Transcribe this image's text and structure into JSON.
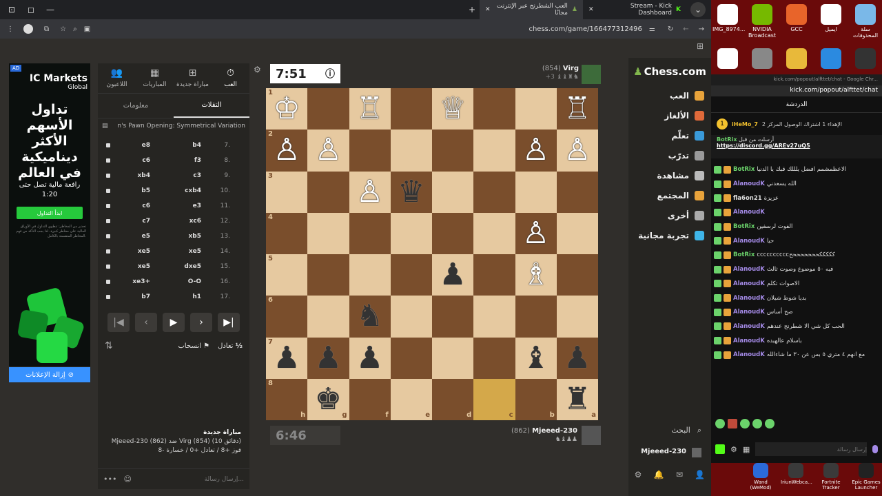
{
  "browser": {
    "tabs": [
      {
        "label": "Stream - Kick Dashboard",
        "active": false
      },
      {
        "label": "العب الشطرنج عبر الإنترنت مجانًا",
        "active": true
      }
    ],
    "address": "chess.com/game/166477312496"
  },
  "ad": {
    "brand": "IC Markets",
    "brand_sub": "Global",
    "headline": "تداول الأسهم الأكثر ديناميكية في العالم",
    "sub": "رافعة مالية تصل حتى 1:20",
    "cta": "ابدأ التداول",
    "disclaimer": "تحذير من المخاطر: تنطوي التداول في الأوراق المالية على مخاطر كبيرة، لذا يجب التأكد من فهم المخاطر المتضمنة بالكامل.",
    "remove_label": "إزالة الإعلانات"
  },
  "left_panel": {
    "tabs": [
      {
        "label": "اللاعبون",
        "icon": "players-icon"
      },
      {
        "label": "المباريات",
        "icon": "games-icon"
      },
      {
        "label": "مباراة جديدة",
        "icon": "plus-icon"
      },
      {
        "label": "العب",
        "icon": "stopwatch-icon",
        "active": true
      }
    ],
    "subtabs": {
      "info": "معلومات",
      "moves": "التقلات"
    },
    "opening": "n's Pawn Opening: Symmetrical Variation",
    "moves": [
      {
        "n": "7.",
        "w": "b4",
        "b": "e8"
      },
      {
        "n": "8.",
        "w": "f3",
        "b": "c6"
      },
      {
        "n": "9.",
        "w": "c3",
        "b": "xb4"
      },
      {
        "n": "10.",
        "w": "cxb4",
        "b": "b5"
      },
      {
        "n": "11.",
        "w": "e3",
        "b": "c6"
      },
      {
        "n": "12.",
        "w": "xc6",
        "b": "c7"
      },
      {
        "n": "13.",
        "w": "xb5",
        "b": "e5"
      },
      {
        "n": "14.",
        "w": "xe5",
        "b": "xe5"
      },
      {
        "n": "15.",
        "w": "dxe5",
        "b": "xe5"
      },
      {
        "n": "16.",
        "w": "O-O",
        "b": "xe3+"
      },
      {
        "n": "17.",
        "w": "h1",
        "b": "b7"
      }
    ],
    "controls": {
      "draw": "تعادل",
      "resign": "انسحاب",
      "draw_prefix": "½"
    },
    "game_info": {
      "title": "مباراة جديدة",
      "line1": "Mjeeed-230 (862) ضد Virg (854) (10 دقائق)",
      "line2": "فوز +8 / تعادل +0 / خسارة -8"
    },
    "chat_placeholder": "إرسال رسالة..."
  },
  "top_player": {
    "name": "Virg",
    "rating": "(854)",
    "captured": "+3",
    "clock": "7:51"
  },
  "bottom_player": {
    "name": "Mjeeed-230",
    "rating": "(862)",
    "clock": "6:46"
  },
  "board": {
    "rank_labels": [
      "1",
      "2",
      "3",
      "4",
      "5",
      "6",
      "7",
      "8"
    ],
    "file_labels": [
      "h",
      "g",
      "f",
      "e",
      "d",
      "c",
      "b",
      "a"
    ],
    "squares": [
      [
        "♔w",
        "",
        "♖w",
        "",
        "♕w",
        "",
        "",
        "♖w"
      ],
      [
        "♙w",
        "♙w",
        "",
        "",
        "",
        "",
        "♙w",
        "♙w"
      ],
      [
        "",
        "",
        "♙w",
        "♛b",
        "",
        "",
        "",
        ""
      ],
      [
        "",
        "",
        "",
        "",
        "",
        "",
        "♙w",
        ""
      ],
      [
        "",
        "",
        "",
        "",
        "♟b",
        "",
        "♗w",
        ""
      ],
      [
        "",
        "",
        "♞b",
        "",
        "",
        "",
        "",
        ""
      ],
      [
        "♟b",
        "♟b",
        "♟b",
        "",
        "",
        "",
        "♝b",
        "♟b"
      ],
      [
        "",
        "♚b",
        "",
        "",
        "",
        "",
        "",
        "♜b"
      ]
    ]
  },
  "right_nav": {
    "logo": "Chess.com",
    "items": [
      {
        "label": "العب",
        "color": "#e8a33b"
      },
      {
        "label": "الألغاز",
        "color": "#e06a3a"
      },
      {
        "label": "تعلّم",
        "color": "#3a9ad9"
      },
      {
        "label": "تدرّب",
        "color": "#9a9a9a"
      },
      {
        "label": "مشاهدة",
        "color": "#bbbbbb"
      },
      {
        "label": "المجتمع",
        "color": "#e8a33b"
      },
      {
        "label": "أخرى",
        "color": "#aaaaaa"
      },
      {
        "label": "تجربة مجانية",
        "color": "#3fb5e8"
      }
    ],
    "search": "البحث",
    "username": "Mjeeed-230"
  },
  "desktop": {
    "icons": [
      {
        "label": "IMG_8974...",
        "color": "#ffffff"
      },
      {
        "label": "NVIDIA Broadcast",
        "color": "#76b900"
      },
      {
        "label": "GCC",
        "color": "#e8642a"
      },
      {
        "label": "ايميل",
        "color": "#ffffff"
      },
      {
        "label": "سلة المحذوفات",
        "color": "#7ab8e8"
      }
    ],
    "kick_url": "kick.com/popout/alfttet/chat - Google Chr...",
    "kick_url2": "kick.com/popout/alfttet/chat",
    "chat_header": "الدردشة",
    "pinned_user": "iHeMo_7",
    "pinned_text": "الإهداء 1 اشتراك الوصول المركز 2",
    "bot_name": "BotRix",
    "bot_text": "أرسلت من قبل",
    "discord": "https://discord.gg/AREv27uQ5",
    "chat": [
      {
        "user": "BotRix",
        "text": "الاعظمشمم افضل يلللك قبك يا الدنيا",
        "color": "#6bd36b"
      },
      {
        "user": "AlanoudK",
        "text": "الله يسعدني",
        "color": "#a58be8"
      },
      {
        "user": "fla6on21",
        "text": "عزيزة",
        "color": "#dddddd"
      },
      {
        "user": "AlanoudK",
        "text": "",
        "color": "#a58be8"
      },
      {
        "user": "BotRix",
        "text": "الفوت لرسفين",
        "color": "#6bd36b"
      },
      {
        "user": "AlanoudK",
        "text": "حيا",
        "color": "#a58be8"
      },
      {
        "user": "BotRix",
        "text": "ccccccccccكككككحححححححح",
        "color": "#6bd36b"
      },
      {
        "user": "AlanoudK",
        "text": "فيه ٥٠ موضوع وصوت ثالث",
        "color": "#a58be8"
      },
      {
        "user": "AlanoudK",
        "text": "الاصوات تكلم",
        "color": "#a58be8"
      },
      {
        "user": "AlanoudK",
        "text": "بديا شوط شيلان",
        "color": "#a58be8"
      },
      {
        "user": "AlanoudK",
        "text": "صح أساس",
        "color": "#a58be8"
      },
      {
        "user": "AlanoudK",
        "text": "الحب كل شي الا شطرنج عندهم",
        "color": "#a58be8"
      },
      {
        "user": "AlanoudK",
        "text": "باسلام عالهبده",
        "color": "#a58be8"
      },
      {
        "user": "AlanoudK",
        "text": "مع انهم ٤ متري ٥ بس عن ٣٠ ما شاءالله",
        "color": "#a58be8"
      }
    ],
    "chat_placeholder": "إرسال رسالة",
    "taskbar": [
      {
        "label": "Wand (WeMod)",
        "color": "#2b6ad9"
      },
      {
        "label": "IriunWebca...",
        "color": "#3a3a3a"
      },
      {
        "label": "Fortnite Tracker",
        "color": "#3a3a3a"
      },
      {
        "label": "Epic Games Launcher",
        "color": "#222222"
      }
    ]
  }
}
